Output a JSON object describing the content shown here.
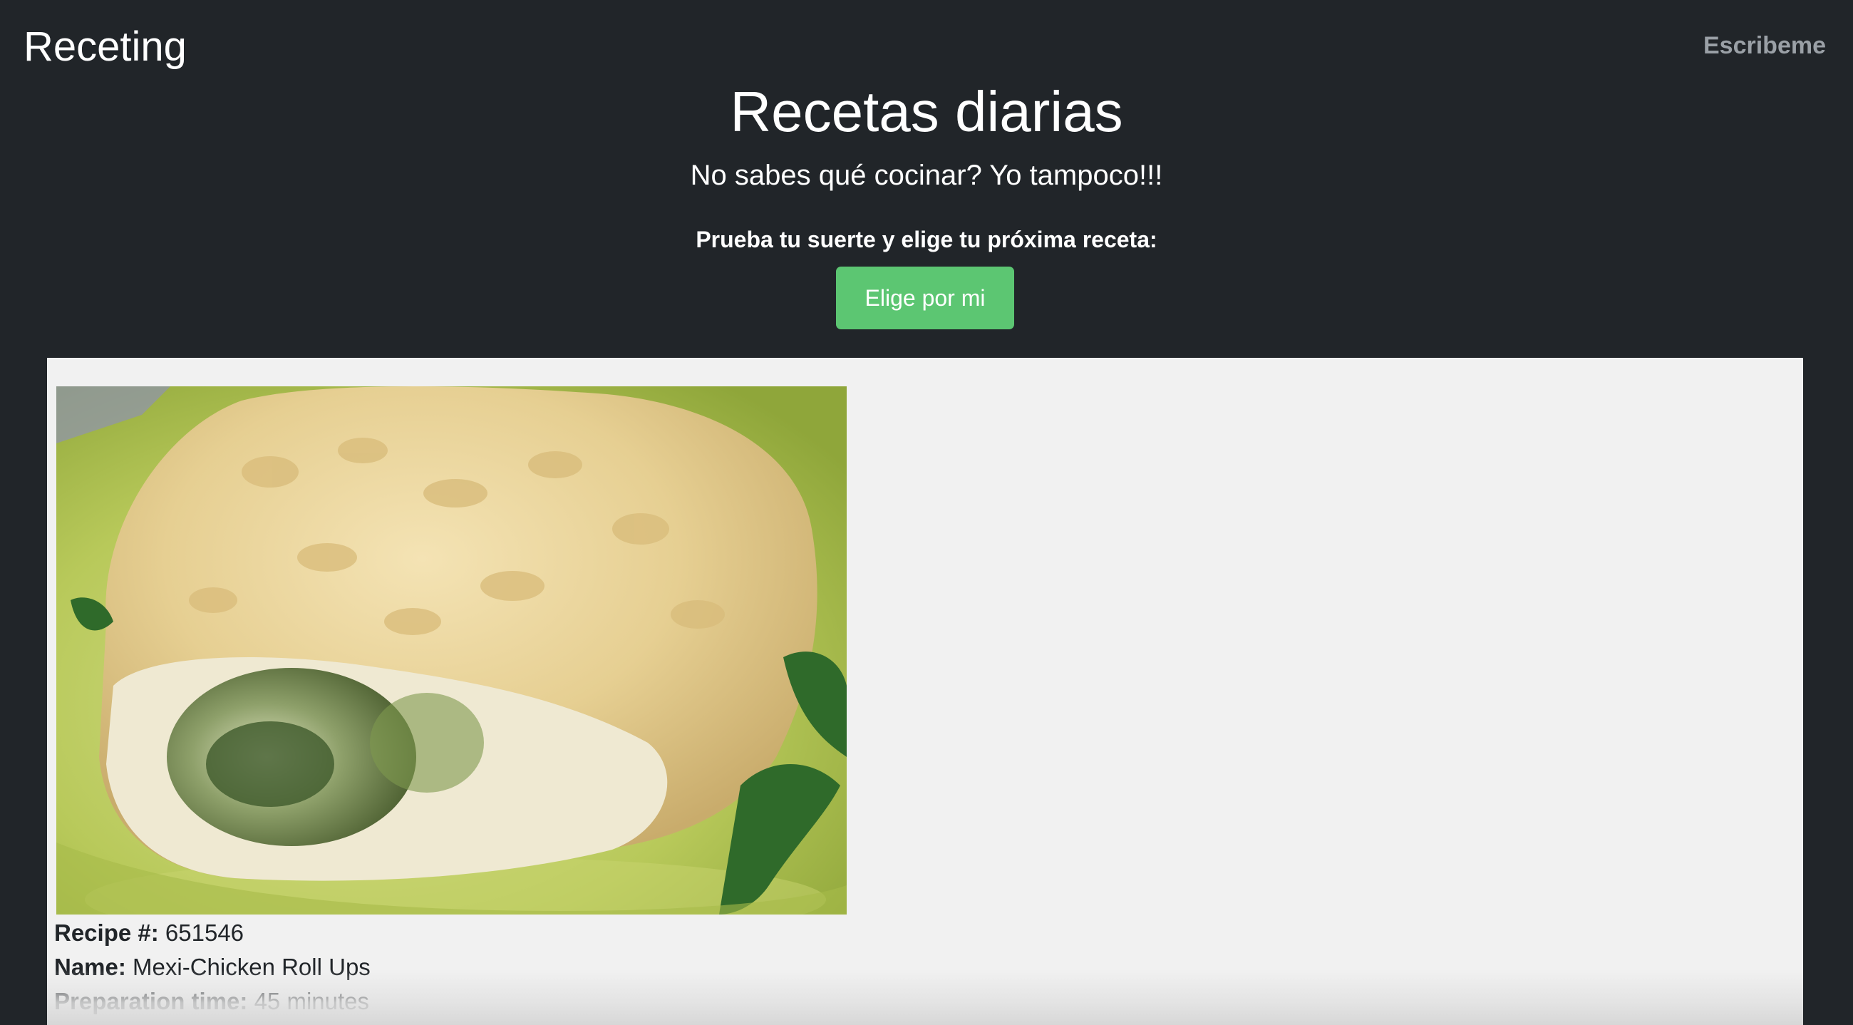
{
  "navbar": {
    "brand": "Receting",
    "link": "Escribeme"
  },
  "hero": {
    "title": "Recetas diarias",
    "subtitle": "No sabes qué cocinar? Yo tampoco!!!",
    "prompt": "Prueba tu suerte y elige tu próxima receta:",
    "button_label": "Elige por mi",
    "button_color": "#5cc672"
  },
  "recipe": {
    "image_alt": "Mexi-Chicken Roll Ups photo",
    "id_label": "Recipe #:",
    "id_value": "651546",
    "name_label": "Name:",
    "name_value": "Mexi-Chicken Roll Ups",
    "time_label": "Preparation time:",
    "time_value": "45 minutes"
  },
  "colors": {
    "background": "#212529",
    "card": "#f1f1f1",
    "accent": "#5cc672"
  }
}
